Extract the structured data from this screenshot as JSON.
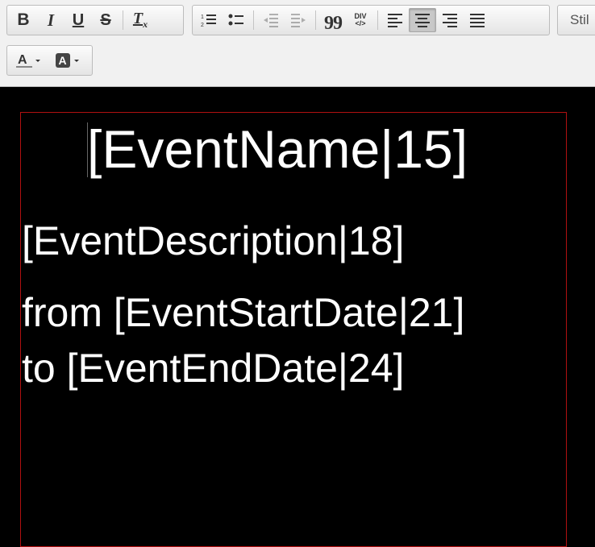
{
  "toolbar": {
    "styles_combo_label": "Stil",
    "buttons": {
      "bold": "B",
      "italic": "I",
      "underline": "U",
      "strike": "S",
      "remove_format": "T",
      "remove_format_sub": "x",
      "blockquote": "99",
      "div_top": "DIV",
      "div_bottom": "</>"
    },
    "icons": [
      "bold-icon",
      "italic-icon",
      "underline-icon",
      "strikethrough-icon",
      "remove-format-icon",
      "numbered-list-icon",
      "bulleted-list-icon",
      "decrease-indent-icon",
      "increase-indent-icon",
      "blockquote-icon",
      "create-div-icon",
      "align-left-icon",
      "align-center-icon",
      "align-right-icon",
      "align-justify-icon",
      "text-color-icon",
      "background-color-icon"
    ],
    "active": "align-center"
  },
  "content": {
    "event_name": "[EventName|15]",
    "event_description": "[EventDescription|18]",
    "start_line": "from [EventStartDate|21]",
    "end_line": "to [EventEndDate|24]"
  },
  "colors": {
    "editor_background": "#000000",
    "text": "#ffffff",
    "frame_border": "#b01010"
  }
}
